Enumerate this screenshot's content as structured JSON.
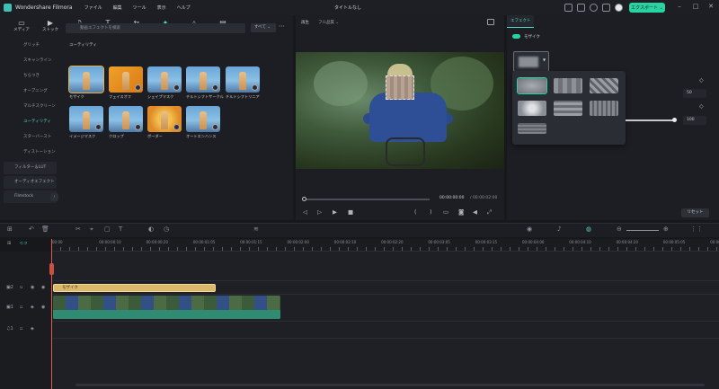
{
  "app": {
    "name": "Wondershare Filmora",
    "doc_title": "タイトルなし",
    "export_label": "エクスポート ⌄"
  },
  "menu": [
    "ファイル",
    "編集",
    "ツール",
    "表示",
    "ヘルプ"
  ],
  "tabs": [
    {
      "icon": "media-icon",
      "glyph": "▭",
      "label": "メディア"
    },
    {
      "icon": "stock-icon",
      "glyph": "▶",
      "label": "ストック"
    },
    {
      "icon": "audio-icon",
      "glyph": "♫",
      "label": "オーディオ"
    },
    {
      "icon": "title-icon",
      "glyph": "T",
      "label": "タイトル"
    },
    {
      "icon": "transition-icon",
      "glyph": "⇆",
      "label": "トランジション"
    },
    {
      "icon": "effects-icon",
      "glyph": "✦",
      "label": "エフェクト"
    },
    {
      "icon": "sticker-icon",
      "glyph": "◬",
      "label": "ステッカー"
    },
    {
      "icon": "template-icon",
      "glyph": "▤",
      "label": "テンプレート"
    }
  ],
  "categories": [
    "グリッチ",
    "スキャンライン",
    "ちらつき",
    "オープニング",
    "マルチスクリーン",
    "ユーティリティ",
    "スターバースト",
    "ディストーション"
  ],
  "category_active_index": 5,
  "category_groups": [
    "フィルター＆LUT",
    "オーディオエフェクト",
    "Filmstock"
  ],
  "search": {
    "placeholder": "動画エフェクトを検索"
  },
  "filter": {
    "label": "すべて ⌄"
  },
  "section_label": "ユーティリティ",
  "effects": [
    {
      "label": "モザイク"
    },
    {
      "label": "フェイスオフ"
    },
    {
      "label": "シェイプマスク"
    },
    {
      "label": "チルトシフトサークル"
    },
    {
      "label": "チルトシフトリニア"
    },
    {
      "label": "イメージマスク"
    },
    {
      "label": "クロップ"
    },
    {
      "label": "ボーダー"
    },
    {
      "label": "オートエンハンス"
    }
  ],
  "player": {
    "header": "再生",
    "quality": "フル品質 ⌄",
    "time_current": "00:00:00:00",
    "time_total": "/ 00:00:02:00"
  },
  "effect_panel": {
    "tab": "エフェクト",
    "effect_name": "モザイク",
    "value1": "50",
    "value2": "100",
    "reset": "リセット"
  },
  "timeline": {
    "ticks": [
      "00:00",
      "00:00:00:10",
      "00:00:00:20",
      "00:00:01:05",
      "00:00:01:15",
      "00:00:02:00",
      "00:00:02:10",
      "00:00:02:20",
      "00:00:03:05",
      "00:00:03:15",
      "00:00:04:00",
      "00:00:04:10",
      "00:00:04:20",
      "00:00:05:05",
      "00:00:05:1"
    ],
    "effect_clip_label": "モザイク"
  }
}
